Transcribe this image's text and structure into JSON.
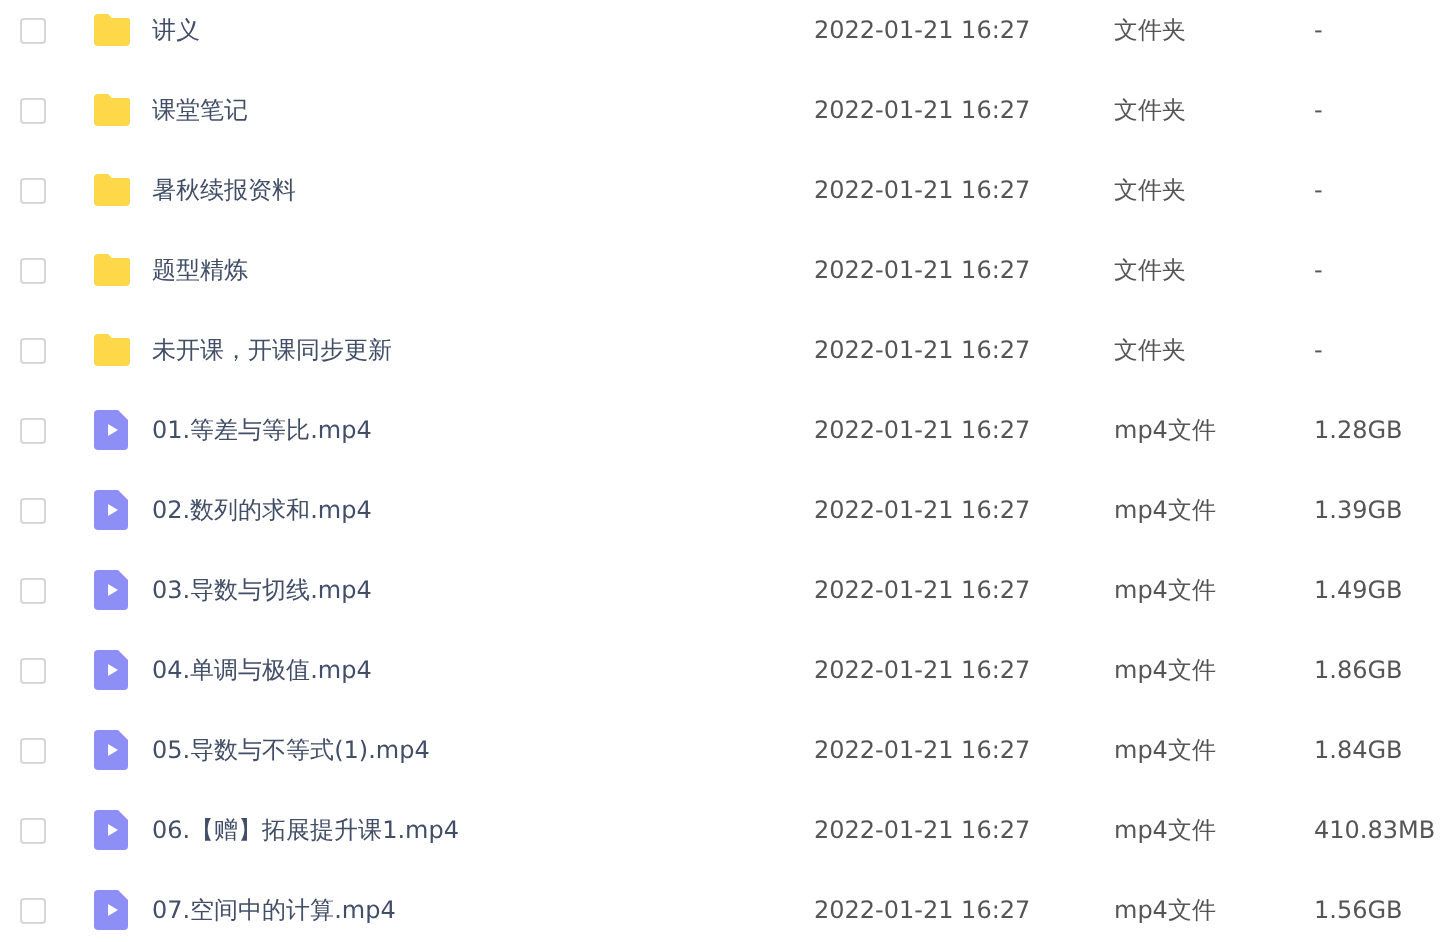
{
  "files": [
    {
      "kind": "folder",
      "checked": false,
      "name": "讲义",
      "modified": "2022-01-21 16:27",
      "type": "文件夹",
      "size": "-"
    },
    {
      "kind": "folder",
      "checked": false,
      "name": "课堂笔记",
      "modified": "2022-01-21 16:27",
      "type": "文件夹",
      "size": "-"
    },
    {
      "kind": "folder",
      "checked": false,
      "name": "暑秋续报资料",
      "modified": "2022-01-21 16:27",
      "type": "文件夹",
      "size": "-"
    },
    {
      "kind": "folder",
      "checked": false,
      "name": "题型精炼",
      "modified": "2022-01-21 16:27",
      "type": "文件夹",
      "size": "-"
    },
    {
      "kind": "folder",
      "checked": false,
      "name": "未开课，开课同步更新",
      "modified": "2022-01-21 16:27",
      "type": "文件夹",
      "size": "-"
    },
    {
      "kind": "video",
      "checked": false,
      "name": "01.等差与等比.mp4",
      "modified": "2022-01-21 16:27",
      "type": "mp4文件",
      "size": "1.28GB"
    },
    {
      "kind": "video",
      "checked": false,
      "name": "02.数列的求和.mp4",
      "modified": "2022-01-21 16:27",
      "type": "mp4文件",
      "size": "1.39GB"
    },
    {
      "kind": "video",
      "checked": false,
      "name": "03.导数与切线.mp4",
      "modified": "2022-01-21 16:27",
      "type": "mp4文件",
      "size": "1.49GB"
    },
    {
      "kind": "video",
      "checked": false,
      "name": "04.单调与极值.mp4",
      "modified": "2022-01-21 16:27",
      "type": "mp4文件",
      "size": "1.86GB"
    },
    {
      "kind": "video",
      "checked": false,
      "name": "05.导数与不等式(1).mp4",
      "modified": "2022-01-21 16:27",
      "type": "mp4文件",
      "size": "1.84GB"
    },
    {
      "kind": "video",
      "checked": false,
      "name": "06.【赠】拓展提升课1.mp4",
      "modified": "2022-01-21 16:27",
      "type": "mp4文件",
      "size": "410.83MB"
    },
    {
      "kind": "video",
      "checked": false,
      "name": "07.空间中的计算.mp4",
      "modified": "2022-01-21 16:27",
      "type": "mp4文件",
      "size": "1.56GB"
    }
  ]
}
